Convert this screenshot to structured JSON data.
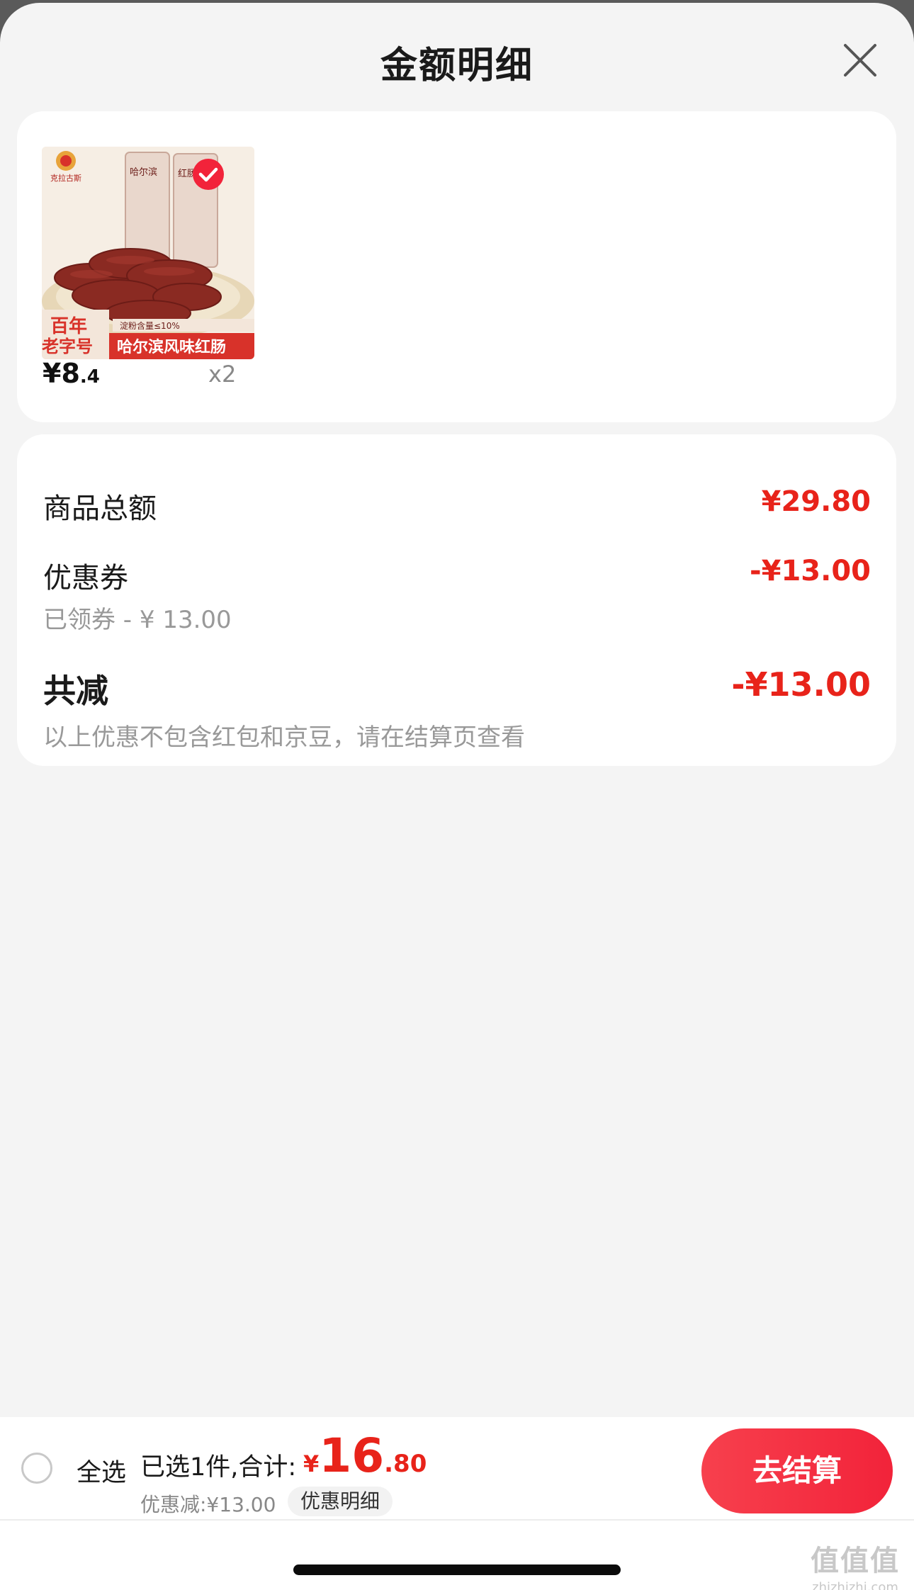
{
  "header": {
    "title": "金额明细"
  },
  "product": {
    "brand": "克拉古斯",
    "badge_text_1": "百年",
    "badge_text_2": "老字号",
    "spec_text": "淀粉含量≤10%",
    "product_name": "哈尔滨风味红肠",
    "package_text_1": "哈尔滨",
    "package_text_2": "红肠",
    "price_int": "¥8",
    "price_dec": ".4",
    "quantity": "x2",
    "selected": true
  },
  "summary": {
    "goods_total_label": "商品总额",
    "goods_total_value": "¥29.80",
    "coupon_label": "优惠券",
    "coupon_value": "-¥13.00",
    "coupon_sub": "已领券 - ¥ 13.00",
    "total_reduce_label": "共减",
    "total_reduce_value": "-¥13.00",
    "note": "以上优惠不包含红包和京豆，请在结算页查看"
  },
  "bottom_bar": {
    "select_all": "全选",
    "selected_text": "已选1件,合计:",
    "total_yen": "¥",
    "total_int": "16",
    "total_dec": ".80",
    "discount_text": "优惠减:¥13.00",
    "detail_link": "优惠明细",
    "checkout": "去结算",
    "all_selected": false
  },
  "watermark": {
    "logo": "值值值",
    "url": "zhizhizhi.com"
  },
  "colors": {
    "accent": "#e8231a",
    "button": "#f2233a",
    "background": "#f4f4f4"
  }
}
